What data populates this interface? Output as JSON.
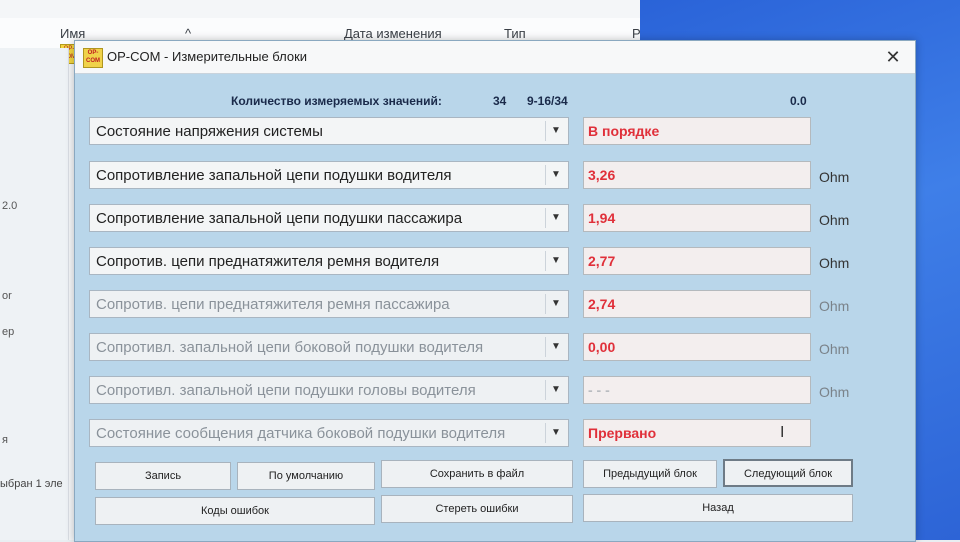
{
  "explorer": {
    "columns": {
      "name": "Имя",
      "date": "Дата изменения",
      "type": "Тип",
      "size": "Р"
    },
    "file_badge": "OP-COM",
    "sidebar_labels": [
      "2.0",
      "or",
      "ер",
      "ыбран 1 эл",
      "я"
    ],
    "status": "ыбран 1 эле"
  },
  "window": {
    "app_icon_text": "OP-COM",
    "title": "OP-COM - Измерительные блоки",
    "close": "✕"
  },
  "header": {
    "count_label": "Количество измеряемых значений:",
    "count_value": "34",
    "range": "9-16/34",
    "top_value": "0.0"
  },
  "rows": [
    {
      "label": "Состояние напряжения системы",
      "value": "В порядке",
      "unit": ""
    },
    {
      "label": "Сопротивление запальной цепи подушки водителя",
      "value": "3,26",
      "unit": "Ohm"
    },
    {
      "label": "Сопротивление запальной цепи подушки пассажира",
      "value": "1,94",
      "unit": "Ohm"
    },
    {
      "label": "Сопротив. цепи преднатяжителя ремня водителя",
      "value": "2,77",
      "unit": "Ohm"
    },
    {
      "label": "Сопротив. цепи преднатяжителя ремня пассажира",
      "value": "2,74",
      "unit": "Ohm"
    },
    {
      "label": "Сопротивл. запальной цепи боковой подушки водителя",
      "value": "0,00",
      "unit": "Ohm"
    },
    {
      "label": "Сопротивл. запальной цепи подушки головы водителя",
      "value": "- - -",
      "unit": "Ohm"
    },
    {
      "label": "Состояние сообщения датчика боковой подушки водителя",
      "value": "Прервано",
      "unit": ""
    }
  ],
  "buttons": {
    "record": "Запись",
    "default": "По умолчанию",
    "save_file": "Сохранить в файл",
    "prev_block": "Предыдущий блок",
    "next_block": "Следующий блок",
    "error_codes": "Коды ошибок",
    "clear_errors": "Стереть ошибки",
    "back": "Назад"
  },
  "colors": {
    "value_text": "#e0303a",
    "window_bg": "#b9d6ea",
    "desktop": "#2d64d6"
  }
}
